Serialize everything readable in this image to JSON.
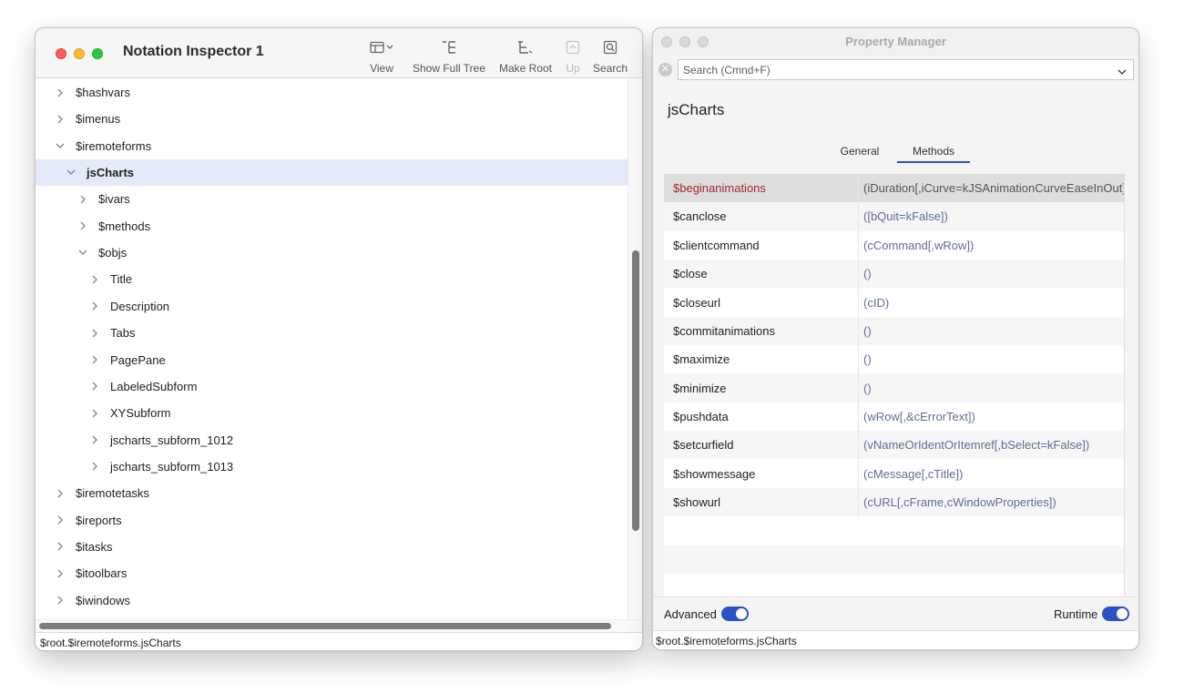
{
  "inspector": {
    "title": "Notation Inspector 1",
    "toolbar": {
      "view": "View",
      "show_full_tree": "Show Full Tree",
      "make_root": "Make Root",
      "up": "Up",
      "search": "Search"
    },
    "tree": [
      {
        "label": "$hashvars",
        "expanded": false,
        "depth": 0
      },
      {
        "label": "$imenus",
        "expanded": false,
        "depth": 0
      },
      {
        "label": "$iremoteforms",
        "expanded": true,
        "depth": 0
      },
      {
        "label": "jsCharts",
        "expanded": true,
        "depth": 1,
        "selected": true
      },
      {
        "label": "$ivars",
        "expanded": false,
        "depth": 2
      },
      {
        "label": "$methods",
        "expanded": false,
        "depth": 2
      },
      {
        "label": "$objs",
        "expanded": true,
        "depth": 2
      },
      {
        "label": "Title",
        "expanded": false,
        "depth": 3
      },
      {
        "label": "Description",
        "expanded": false,
        "depth": 3
      },
      {
        "label": "Tabs",
        "expanded": false,
        "depth": 3
      },
      {
        "label": "PagePane",
        "expanded": false,
        "depth": 3
      },
      {
        "label": "LabeledSubform",
        "expanded": false,
        "depth": 3
      },
      {
        "label": "XYSubform",
        "expanded": false,
        "depth": 3
      },
      {
        "label": "jscharts_subform_1012",
        "expanded": false,
        "depth": 3
      },
      {
        "label": "jscharts_subform_1013",
        "expanded": false,
        "depth": 3
      },
      {
        "label": "$iremotetasks",
        "expanded": false,
        "depth": 0
      },
      {
        "label": "$ireports",
        "expanded": false,
        "depth": 0
      },
      {
        "label": "$itasks",
        "expanded": false,
        "depth": 0
      },
      {
        "label": "$itoolbars",
        "expanded": false,
        "depth": 0
      },
      {
        "label": "$iwindows",
        "expanded": false,
        "depth": 0
      }
    ],
    "status": "$root.$iremoteforms.jsCharts"
  },
  "property_manager": {
    "title": "Property Manager",
    "search": {
      "placeholder": "Search (Cmnd+F)",
      "value": ""
    },
    "object_name": "jsCharts",
    "tabs": [
      {
        "label": "General",
        "active": false
      },
      {
        "label": "Methods",
        "active": true
      }
    ],
    "methods": [
      {
        "name": "$beginanimations",
        "signature": "(iDuration[,iCurve=kJSAnimationCurveEaseInOut])",
        "selected": true
      },
      {
        "name": "$canclose",
        "signature": "([bQuit=kFalse])"
      },
      {
        "name": "$clientcommand",
        "signature": "(cCommand[,wRow])"
      },
      {
        "name": "$close",
        "signature": "()"
      },
      {
        "name": "$closeurl",
        "signature": "(cID)"
      },
      {
        "name": "$commitanimations",
        "signature": "()"
      },
      {
        "name": "$maximize",
        "signature": "()"
      },
      {
        "name": "$minimize",
        "signature": "()"
      },
      {
        "name": "$pushdata",
        "signature": "(wRow[,&cErrorText])"
      },
      {
        "name": "$setcurfield",
        "signature": "(vNameOrIdentOrItemref[,bSelect=kFalse])"
      },
      {
        "name": "$showmessage",
        "signature": "(cMessage[,cTitle])"
      },
      {
        "name": "$showurl",
        "signature": "(cURL[,cFrame,cWindowProperties])"
      }
    ],
    "footer": {
      "advanced_label": "Advanced",
      "advanced_on": true,
      "runtime_label": "Runtime",
      "runtime_on": true
    },
    "status": "$root.$iremoteforms.jsCharts"
  },
  "colors": {
    "accent": "#2a54c6",
    "selected_row": "#e5eaf8",
    "method_selected_text": "#a3282a",
    "signature_text": "#5f6f99"
  }
}
